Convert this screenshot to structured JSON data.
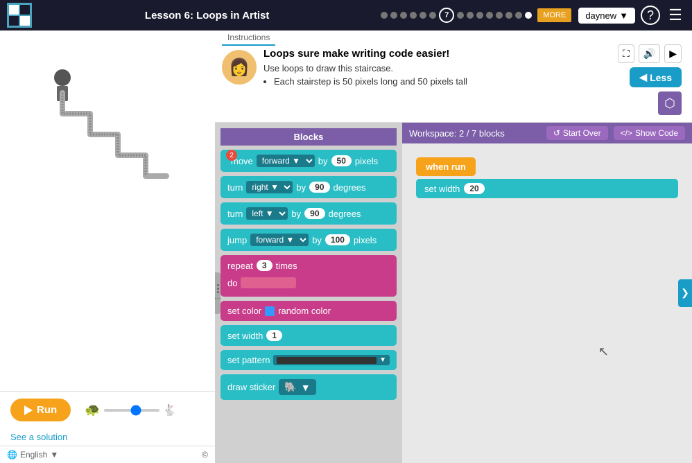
{
  "header": {
    "title": "Lesson 6: Loops in Artist",
    "progress_current": "7",
    "more_label": "MORE",
    "user_label": "daynew",
    "help_icon": "?",
    "menu_icon": "☰"
  },
  "instructions": {
    "tab_label": "Instructions",
    "title": "Loops sure make writing code easier!",
    "body": "Use loops to draw this staircase.",
    "bullet": "Each stairstep is 50 pixels long and 50 pixels tall",
    "less_label": "Less"
  },
  "workspace": {
    "blocks_header": "Blocks",
    "workspace_header": "Workspace: 2 / 7 blocks",
    "start_over_label": "Start Over",
    "show_code_label": "Show Code"
  },
  "blocks": [
    {
      "id": "move",
      "label": "move",
      "dropdown": "forward ▼",
      "value": "50",
      "unit": "pixels",
      "badge": "2"
    },
    {
      "id": "turn-right",
      "label": "turn",
      "dropdown": "right ▼",
      "value": "90",
      "unit": "degrees"
    },
    {
      "id": "turn-left",
      "label": "turn",
      "dropdown": "left ▼",
      "value": "90",
      "unit": "degrees"
    },
    {
      "id": "jump",
      "label": "jump",
      "dropdown": "forward ▼",
      "value": "100",
      "unit": "pixels"
    },
    {
      "id": "repeat",
      "label": "repeat",
      "value": "3",
      "unit": "times"
    },
    {
      "id": "set-color",
      "label": "set color",
      "extra": "random color"
    },
    {
      "id": "set-width",
      "label": "set width",
      "value": "1"
    },
    {
      "id": "set-pattern",
      "label": "set pattern"
    },
    {
      "id": "draw-sticker",
      "label": "draw sticker",
      "emoji": "🐘"
    }
  ],
  "workspace_blocks": {
    "when_run": "when run",
    "set_width": "set width",
    "set_width_value": "20"
  },
  "controls": {
    "run_label": "Run",
    "see_solution": "See a solution"
  },
  "footer": {
    "language": "English",
    "copyright": "©"
  }
}
